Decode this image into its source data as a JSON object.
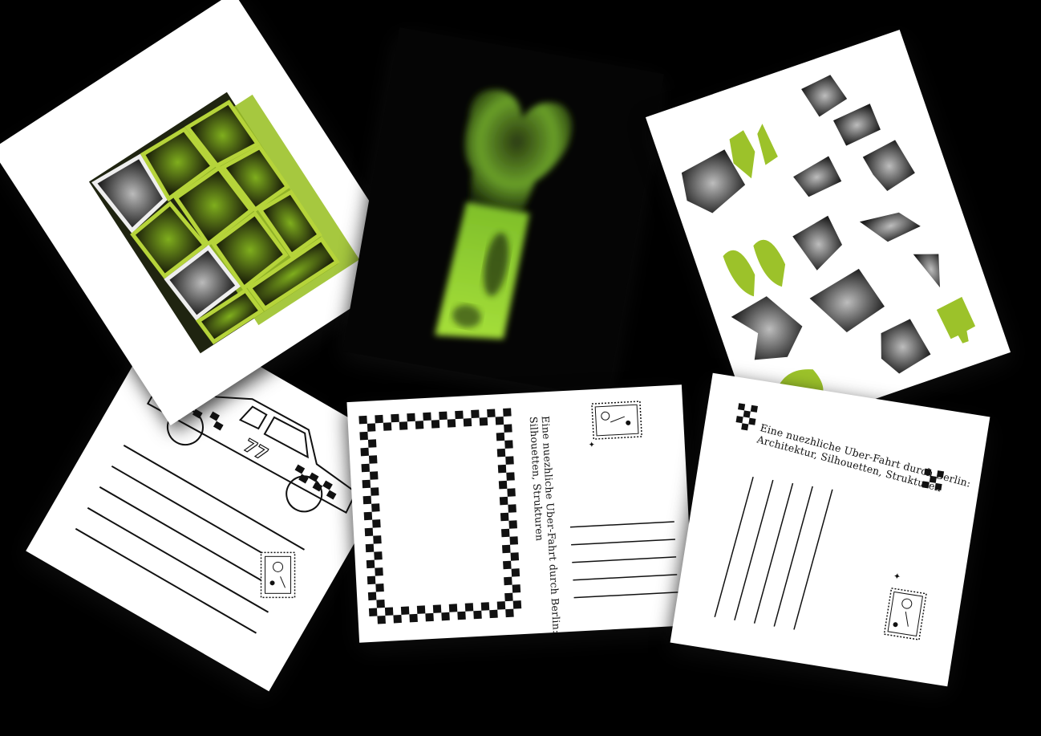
{
  "scene": {
    "background": "#000000",
    "accent_green": "#9cc22a",
    "card_white": "#ffffff"
  },
  "postcards": [
    {
      "id": "green-structure",
      "kind": "art-front"
    },
    {
      "id": "glow-bone",
      "kind": "art-front"
    },
    {
      "id": "shapes-sheet",
      "kind": "art-front"
    },
    {
      "id": "taxi-back",
      "kind": "postcard-back"
    },
    {
      "id": "checker-frame-back",
      "kind": "postcard-back",
      "caption_line1": "Eine nuezhliche Uber-Fahrt durch Berlin: Architektur,",
      "caption_line2": "Silhouetten, Strukturen"
    },
    {
      "id": "checker-back",
      "kind": "postcard-back",
      "caption_line1": "Eine nuezhliche Uber-Fahrt durch Berlin:",
      "caption_line2": "Architektur, Silhouetten, Strukturen"
    }
  ],
  "taxi": {
    "number": "77"
  }
}
